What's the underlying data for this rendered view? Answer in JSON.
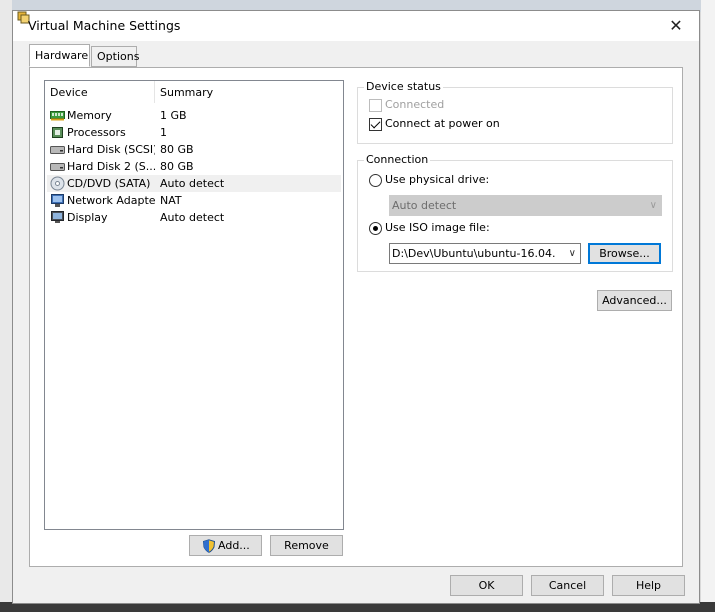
{
  "window": {
    "title": "Virtual Machine Settings",
    "close_glyph": "✕"
  },
  "tabs": [
    {
      "label": "Hardware"
    },
    {
      "label": "Options"
    }
  ],
  "device_list": {
    "columns": {
      "device": "Device",
      "summary": "Summary"
    },
    "rows": [
      {
        "name": "Memory",
        "summary": "1 GB",
        "icon": "memory-icon"
      },
      {
        "name": "Processors",
        "summary": "1",
        "icon": "processor-icon"
      },
      {
        "name": "Hard Disk (SCSI)",
        "summary": "80 GB",
        "icon": "hard-disk-icon"
      },
      {
        "name": "Hard Disk 2 (S...",
        "summary": "80 GB",
        "icon": "hard-disk-icon"
      },
      {
        "name": "CD/DVD (SATA)",
        "summary": "Auto detect",
        "icon": "cd-dvd-icon"
      },
      {
        "name": "Network Adapter",
        "summary": "NAT",
        "icon": "network-adapter-icon"
      },
      {
        "name": "Display",
        "summary": "Auto detect",
        "icon": "display-icon"
      }
    ],
    "add_label": "Add...",
    "remove_label": "Remove"
  },
  "device_status": {
    "title": "Device status",
    "connected_label": "Connected",
    "connect_power_label": "Connect at power on"
  },
  "connection": {
    "title": "Connection",
    "physical_label": "Use physical drive:",
    "physical_value": "Auto detect",
    "iso_label": "Use ISO image file:",
    "iso_value": "D:\\Dev\\Ubuntu\\ubuntu-16.04.",
    "browse_label": "Browse..."
  },
  "advanced_label": "Advanced...",
  "footer": {
    "ok": "OK",
    "cancel": "Cancel",
    "help": "Help"
  }
}
